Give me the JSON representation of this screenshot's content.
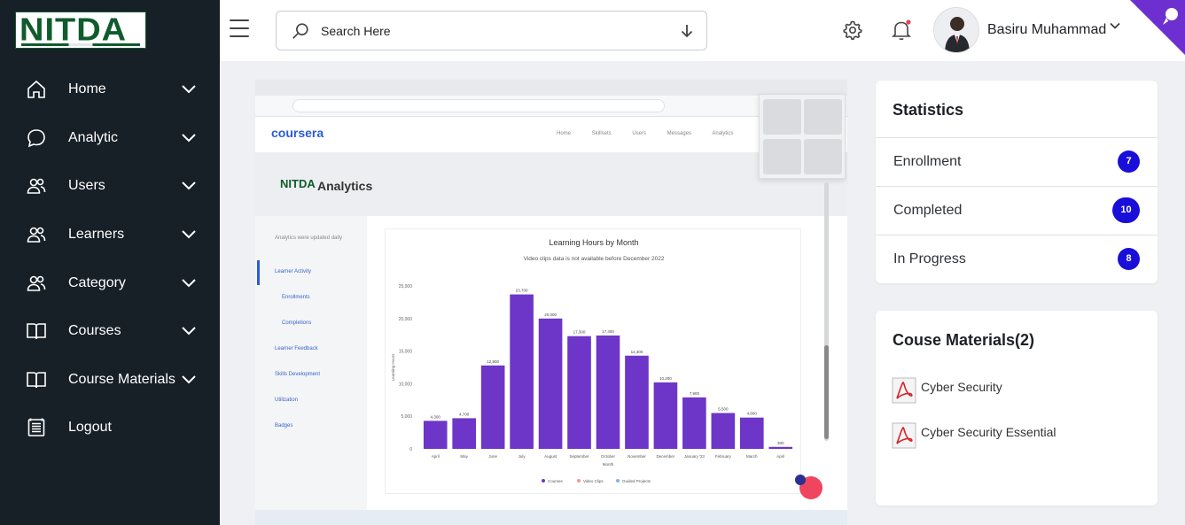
{
  "app": {
    "logo_text": "NITDA"
  },
  "sidebar": {
    "items": [
      {
        "label": "Home",
        "icon": "home-icon"
      },
      {
        "label": "Analytic",
        "icon": "chat-bubble-icon"
      },
      {
        "label": "Users",
        "icon": "users-icon"
      },
      {
        "label": "Learners",
        "icon": "users-icon"
      },
      {
        "label": "Category",
        "icon": "users-icon"
      },
      {
        "label": "Courses",
        "icon": "open-book-icon"
      },
      {
        "label": "Course Materials",
        "icon": "open-book-icon"
      },
      {
        "label": "Logout",
        "icon": "logout-list-icon"
      }
    ]
  },
  "header": {
    "search_placeholder": "Search Here",
    "user_name": "Basiru Muhammad"
  },
  "screenshot": {
    "brand": "coursera",
    "nav_items": "Home Skillsets Users Messages Analytics",
    "page_logo": "NITDA",
    "page_title": "Analytics",
    "side_menu": [
      "Analytics were updated daily",
      "Learner Activity",
      "Enrollments",
      "Completions",
      "Learner Feedback",
      "Skills Development",
      "Utilization",
      "Badges"
    ]
  },
  "chart_data": {
    "type": "bar",
    "title": "Learning Hours by Month",
    "subtitle": "Video clips data is not available before December 2022",
    "xlabel": "Month",
    "ylabel": "Learning Hours",
    "ylim": [
      0,
      25000
    ],
    "yticks": [
      "0",
      "5,000",
      "10,000",
      "15,000",
      "20,000",
      "25,000"
    ],
    "categories": [
      "April",
      "May",
      "June",
      "July",
      "August",
      "September",
      "October",
      "November",
      "December",
      "January '23",
      "February",
      "March",
      "April"
    ],
    "values": [
      4300,
      4700,
      12800,
      23700,
      20000,
      17300,
      17400,
      14300,
      10200,
      7900,
      5500,
      4800,
      300
    ],
    "value_labels": [
      "4,300",
      "4,700",
      "12,800",
      "23,700",
      "20,000",
      "17,300",
      "17,400",
      "14,300",
      "10,200",
      "7,900",
      "5,500",
      "4,800",
      "300"
    ],
    "legend": [
      "Courses",
      "Video Clips",
      "Guided Projects"
    ],
    "legend_position": "bottom",
    "colors": {
      "bar": "#6d35c8",
      "courses": "#6d35c8",
      "video_clips": "#f19999",
      "guided_projects": "#7fb2e8"
    }
  },
  "statistics": {
    "title": "Statistics",
    "rows": [
      {
        "label": "Enrollment",
        "count": "7"
      },
      {
        "label": "Completed",
        "count": "10"
      },
      {
        "label": "In Progress",
        "count": "8"
      }
    ]
  },
  "materials": {
    "title": "Couse Materials(2)",
    "items": [
      {
        "label": "Cyber Security",
        "icon": "pdf-icon"
      },
      {
        "label": "Cyber Security Essential",
        "icon": "pdf-icon"
      }
    ]
  },
  "colors": {
    "sidebar_bg": "#172027",
    "badge": "#1a0ed9",
    "corner": "#6e2fd0"
  }
}
